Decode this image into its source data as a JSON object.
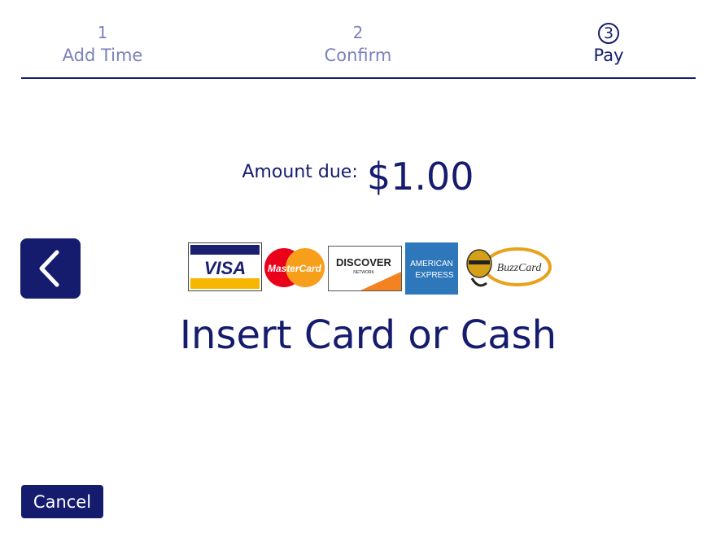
{
  "steps": [
    {
      "number": "1",
      "label": "Add Time"
    },
    {
      "number": "2",
      "label": "Confirm"
    },
    {
      "number": "3",
      "label": "Pay"
    }
  ],
  "current_step": 3,
  "payment": {
    "amount_label": "Amount due:",
    "amount_value": "$1.00",
    "instruction": "Insert Card or Cash"
  },
  "accepted_cards": [
    "VISA",
    "MasterCard",
    "DISCOVER",
    "AMERICAN EXPRESS",
    "BuzzCard"
  ],
  "card_logo_text": {
    "visa": "VISA",
    "mastercard": "MasterCard",
    "discover": "DISCOVER",
    "discover_sub": "NETWORK",
    "amex_line1": "AMERICAN",
    "amex_line2": "EXPRESS",
    "buzzcard": "BuzzCard"
  },
  "icons": {
    "back": "chevron-left-icon"
  },
  "actions": {
    "cancel_label": "Cancel"
  },
  "colors": {
    "primary": "#151c6e",
    "inactive_step": "#7b82b9",
    "background": "#ffffff"
  }
}
